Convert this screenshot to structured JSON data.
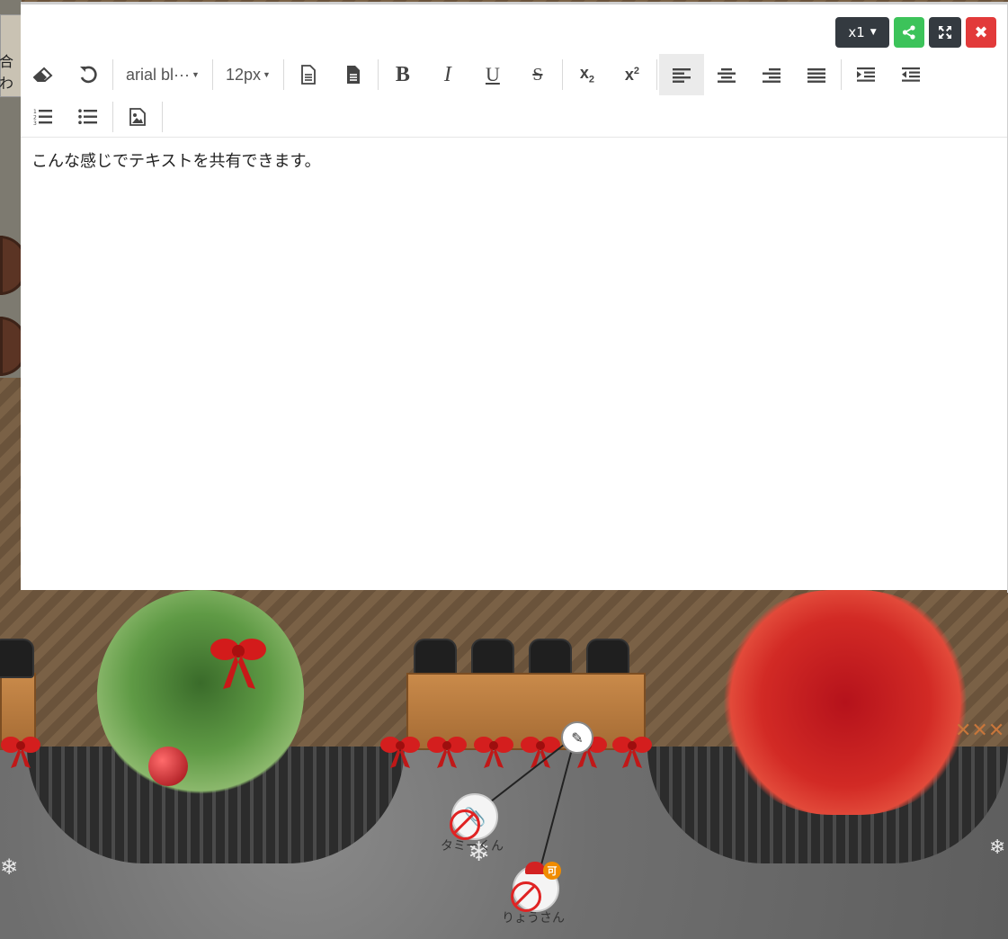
{
  "window": {
    "zoom_label": "x1",
    "close_glyph": "✖"
  },
  "toolbar": {
    "font_family": "arial bl···",
    "font_size": "12px"
  },
  "editor": {
    "text": "こんな感じでテキストを共有できます。"
  },
  "background": {
    "left_thumb_text": "合わ",
    "avatars": [
      {
        "name": "タミーくん"
      },
      {
        "name": "りょうさん",
        "badge": "可"
      }
    ]
  },
  "colors": {
    "share": "#3cc35a",
    "close": "#e23a3a",
    "dark": "#343a40"
  }
}
